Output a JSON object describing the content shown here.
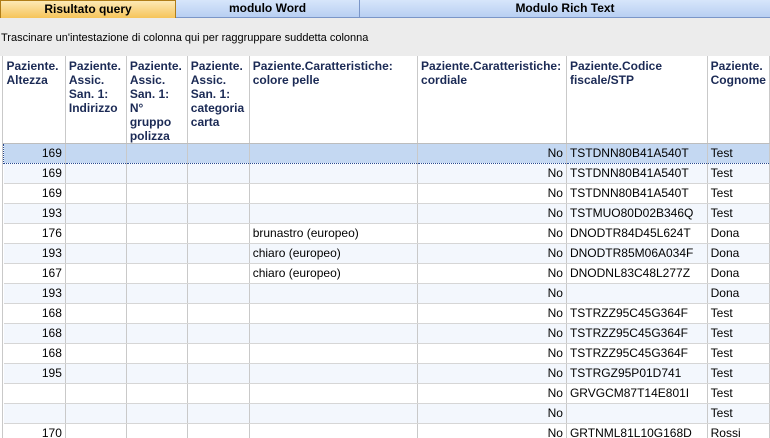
{
  "tabs": [
    {
      "label": "Risultato query",
      "active": true
    },
    {
      "label": "modulo Word",
      "active": false
    },
    {
      "label": "Modulo Rich Text",
      "active": false
    }
  ],
  "group_hint": "Trascinare un'intestazione di colonna qui per raggruppare suddetta colonna",
  "columns": [
    "Paziente. Altezza",
    "Paziente. Assic. San. 1: Indirizzo",
    "Paziente. Assic. San. 1: N° gruppo polizza",
    "Paziente. Assic. San. 1: categoria carta",
    "Paziente.Caratteristiche: colore pelle",
    "Paziente.Caratteristiche: cordiale",
    "Paziente.Codice fiscale/STP",
    "Paziente. Cognome"
  ],
  "rows": [
    {
      "altezza": "169",
      "indirizzo": "",
      "gruppo": "",
      "categoria": "",
      "pelle": "",
      "cordiale": "No",
      "cf": "TSTDNN80B41A540T",
      "cognome": "Test"
    },
    {
      "altezza": "169",
      "indirizzo": "",
      "gruppo": "",
      "categoria": "",
      "pelle": "",
      "cordiale": "No",
      "cf": "TSTDNN80B41A540T",
      "cognome": "Test"
    },
    {
      "altezza": "169",
      "indirizzo": "",
      "gruppo": "",
      "categoria": "",
      "pelle": "",
      "cordiale": "No",
      "cf": "TSTDNN80B41A540T",
      "cognome": "Test"
    },
    {
      "altezza": "193",
      "indirizzo": "",
      "gruppo": "",
      "categoria": "",
      "pelle": "",
      "cordiale": "No",
      "cf": "TSTMUO80D02B346Q",
      "cognome": "Test"
    },
    {
      "altezza": "176",
      "indirizzo": "",
      "gruppo": "",
      "categoria": "",
      "pelle": "brunastro (europeo)",
      "cordiale": "No",
      "cf": "DNODTR84D45L624T",
      "cognome": "Dona"
    },
    {
      "altezza": "193",
      "indirizzo": "",
      "gruppo": "",
      "categoria": "",
      "pelle": "chiaro (europeo)",
      "cordiale": "No",
      "cf": "DNODTR85M06A034F",
      "cognome": "Dona"
    },
    {
      "altezza": "167",
      "indirizzo": "",
      "gruppo": "",
      "categoria": "",
      "pelle": "chiaro (europeo)",
      "cordiale": "No",
      "cf": "DNODNL83C48L277Z",
      "cognome": "Dona"
    },
    {
      "altezza": "193",
      "indirizzo": "",
      "gruppo": "",
      "categoria": "",
      "pelle": "",
      "cordiale": "No",
      "cf": "",
      "cognome": "Dona"
    },
    {
      "altezza": "168",
      "indirizzo": "",
      "gruppo": "",
      "categoria": "",
      "pelle": "",
      "cordiale": "No",
      "cf": "TSTRZZ95C45G364F",
      "cognome": "Test"
    },
    {
      "altezza": "168",
      "indirizzo": "",
      "gruppo": "",
      "categoria": "",
      "pelle": "",
      "cordiale": "No",
      "cf": "TSTRZZ95C45G364F",
      "cognome": "Test"
    },
    {
      "altezza": "168",
      "indirizzo": "",
      "gruppo": "",
      "categoria": "",
      "pelle": "",
      "cordiale": "No",
      "cf": "TSTRZZ95C45G364F",
      "cognome": "Test"
    },
    {
      "altezza": "195",
      "indirizzo": "",
      "gruppo": "",
      "categoria": "",
      "pelle": "",
      "cordiale": "No",
      "cf": "TSTRGZ95P01D741",
      "cognome": "Test"
    },
    {
      "altezza": "",
      "indirizzo": "",
      "gruppo": "",
      "categoria": "",
      "pelle": "",
      "cordiale": "No",
      "cf": "GRVGCM87T14E801I",
      "cognome": "Test"
    },
    {
      "altezza": "",
      "indirizzo": "",
      "gruppo": "",
      "categoria": "",
      "pelle": "",
      "cordiale": "No",
      "cf": "",
      "cognome": "Test"
    },
    {
      "altezza": "170",
      "indirizzo": "",
      "gruppo": "",
      "categoria": "",
      "pelle": "",
      "cordiale": "No",
      "cf": "GRTNML81L10G168D",
      "cognome": "Rossi"
    }
  ],
  "selected_row": 0
}
